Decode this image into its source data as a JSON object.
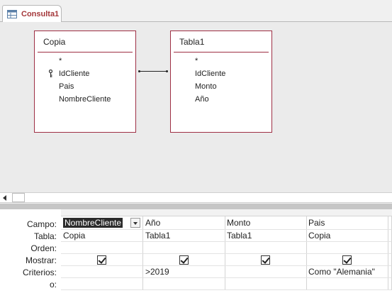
{
  "tab": {
    "label": "Consulta1"
  },
  "tables": [
    {
      "title": "Copia",
      "fields": [
        "*",
        "IdCliente",
        "Pais",
        "NombreCliente"
      ],
      "key_field_index": 1
    },
    {
      "title": "Tabla1",
      "fields": [
        "*",
        "IdCliente",
        "Monto",
        "Año"
      ]
    }
  ],
  "grid": {
    "row_labels": [
      "Campo:",
      "Tabla:",
      "Orden:",
      "Mostrar:",
      "Criterios:",
      "o:"
    ],
    "columns": [
      {
        "campo": "NombreCliente",
        "tabla": "Copia",
        "orden": "",
        "mostrar": true,
        "criterios": "",
        "o": ""
      },
      {
        "campo": "Año",
        "tabla": "Tabla1",
        "orden": "",
        "mostrar": true,
        "criterios": ">2019",
        "o": ""
      },
      {
        "campo": "Monto",
        "tabla": "Tabla1",
        "orden": "",
        "mostrar": true,
        "criterios": "",
        "o": ""
      },
      {
        "campo": "Pais",
        "tabla": "Copia",
        "orden": "",
        "mostrar": true,
        "criterios": "Como \"Alemania\"",
        "o": ""
      }
    ]
  },
  "colors": {
    "tab_text": "#a4373a",
    "table_border": "#9e2f44",
    "selection": "#2b2b2b"
  }
}
